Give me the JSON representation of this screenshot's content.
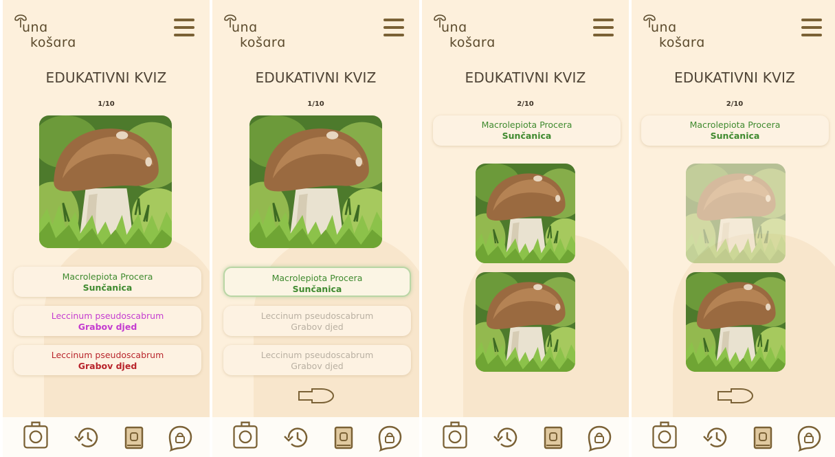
{
  "app": {
    "logo_line1": "unɑ",
    "logo_line2": "košɑrɑ",
    "quiz_title": "EDUKATIVNI KVIZ"
  },
  "screens": [
    {
      "counter": "1/10",
      "answers": [
        {
          "scientific": "Macrolepiota Procera",
          "common": "Sunčanica",
          "color": "#3f8a2f"
        },
        {
          "scientific": "Leccinum pseudoscabrum",
          "common": "Grabov djed",
          "color": "#c43cd0"
        },
        {
          "scientific": "Leccinum pseudoscabrum",
          "common": "Grabov djed",
          "color": "#b8242b"
        }
      ]
    },
    {
      "counter": "1/10",
      "answers": [
        {
          "scientific": "Macrolepiota Procera",
          "common": "Sunčanica",
          "color": "#3f8a2f"
        },
        {
          "scientific": "Leccinum pseudoscabrum",
          "common": "Grabov djed",
          "color": "#b9b0a2"
        },
        {
          "scientific": "Leccinum pseudoscabrum",
          "common": "Grabov djed",
          "color": "#b9b0a2"
        }
      ]
    },
    {
      "counter": "2/10",
      "question": {
        "scientific": "Macrolepiota Procera",
        "common": "Sunčanica",
        "color": "#3f8a2f"
      }
    },
    {
      "counter": "2/10",
      "question": {
        "scientific": "Macrolepiota Procera",
        "common": "Sunčanica",
        "color": "#3f8a2f"
      }
    }
  ],
  "nav": {
    "items": [
      "basket-icon",
      "history-icon",
      "book-icon",
      "chat-lock-icon"
    ],
    "icon_color": "#7a6135"
  },
  "colors": {
    "background": "#fdf0dc",
    "accent_brown": "#7a6135",
    "correct_green": "#3f8a2f"
  }
}
